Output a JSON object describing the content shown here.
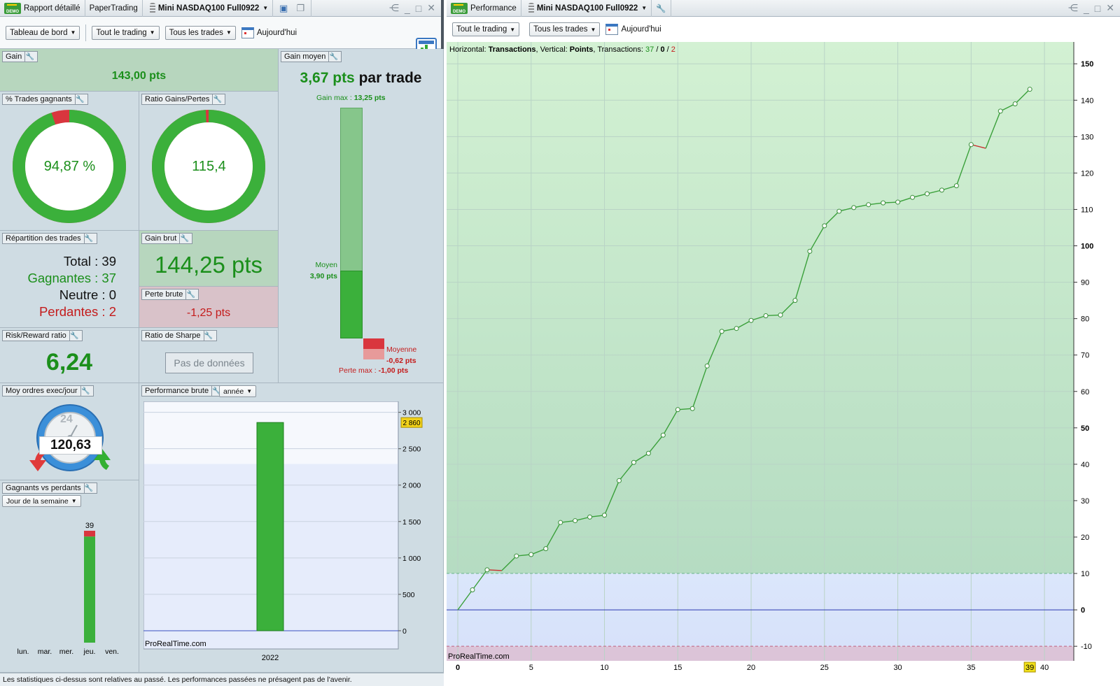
{
  "left_window": {
    "titlebar": {
      "demo_badge": "DEMO",
      "report_tab": "Rapport détaillé",
      "account": "PaperTrading",
      "instrument": "Mini NASDAQ100 Full0922"
    },
    "toolbar": {
      "dashboard": "Tableau de bord",
      "trading_filter": "Tout le trading",
      "trades_filter": "Tous les trades",
      "date_label": "Aujourd'hui"
    },
    "panels": {
      "gain": {
        "title": "Gain",
        "value": "143,00 pts"
      },
      "gain_moyen": {
        "title": "Gain moyen",
        "value": "3,67 pts",
        "suffix": " par trade",
        "gain_max_label": "Gain max : ",
        "gain_max_value": "13,25 pts",
        "moyen_label": "Moyen",
        "moyen_value": "3,90 pts",
        "moyenne_label": "Moyenne",
        "moyenne_value": "-0,62 pts",
        "perte_max_label": "Perte max : ",
        "perte_max_value": "-1,00 pts",
        "bar_max_pts": 13.25,
        "bar_avg_gain_pts": 3.9,
        "bar_avg_loss_pts": -0.62,
        "bar_max_loss_pts": -1.0
      },
      "pct_winning": {
        "title": "% Trades gagnants",
        "value": "94,87 %",
        "fraction": 0.9487
      },
      "ratio_gains_pertes": {
        "title": "Ratio Gains/Pertes",
        "value": "115,4",
        "fraction": 0.9914
      },
      "repartition": {
        "title": "Répartition des trades",
        "total": "Total : 39",
        "gagnantes": "Gagnantes : 37",
        "neutre": "Neutre : 0",
        "perdantes": "Perdantes : 2"
      },
      "gain_brut": {
        "title": "Gain brut",
        "value": "144,25 pts"
      },
      "perte_brute": {
        "title": "Perte brute",
        "value": "-1,25 pts"
      },
      "risk_reward": {
        "title": "Risk/Reward ratio",
        "value": "6,24"
      },
      "sharpe": {
        "title": "Ratio de Sharpe",
        "value": "Pas de données"
      },
      "moy_ordres": {
        "title": "Moy ordres exec/jour",
        "gauge_label": "24",
        "value": "120,63"
      },
      "perf_brute": {
        "title": "Performance brute",
        "period": "année",
        "watermark": "ProRealTime.com",
        "marker": "2 860"
      },
      "gagnants_vs_perdants": {
        "title": "Gagnants vs perdants",
        "mode": "Jour de la semaine",
        "top_count": "39"
      }
    },
    "status": "Les statistiques ci-dessus sont relatives au passé. Les performances passées ne présagent pas de l'avenir."
  },
  "right_window": {
    "titlebar": {
      "demo_badge": "DEMO",
      "tab": "Performance",
      "instrument": "Mini NASDAQ100 Full0922"
    },
    "toolbar": {
      "trading_filter": "Tout le trading",
      "trades_filter": "Tous les trades",
      "date_label": "Aujourd'hui"
    },
    "chart_header": {
      "h_label": "Horizontal: ",
      "h_value": "Transactions",
      "v_label": ", Vertical: ",
      "v_value": "Points",
      "t_label": ", Transactions: ",
      "t_win": "37",
      "t_sep1": " / ",
      "t_neutral": "0",
      "t_sep2": " / ",
      "t_loss": "2"
    },
    "watermark": "ProRealTime.com",
    "x_highlight": "39"
  },
  "chart_data": [
    {
      "type": "line",
      "title": "",
      "xlabel": "Transactions",
      "ylabel": "Points",
      "xlim": [
        0,
        42
      ],
      "ylim": [
        -14,
        156
      ],
      "x_ticks": [
        0,
        5,
        10,
        15,
        20,
        25,
        30,
        35,
        40
      ],
      "y_ticks": [
        -10,
        0,
        10,
        20,
        30,
        40,
        50,
        60,
        70,
        80,
        90,
        100,
        110,
        120,
        130,
        140,
        150
      ],
      "grid": true,
      "series": [
        {
          "x": [
            0,
            1,
            2,
            3,
            4,
            5,
            6,
            7,
            8,
            9,
            10,
            11,
            12,
            13,
            14,
            15,
            16,
            17,
            18,
            19,
            20,
            21,
            22,
            23,
            24,
            25,
            26,
            27,
            28,
            29,
            30,
            31,
            32,
            33,
            34,
            35,
            36,
            37,
            38,
            39
          ],
          "values": [
            0,
            5.5,
            11,
            10.8,
            14.8,
            15.2,
            16.8,
            24,
            24.5,
            25.5,
            26,
            35.5,
            40.5,
            43,
            48,
            55,
            55.3,
            67,
            76.5,
            77.3,
            79.5,
            80.8,
            81,
            85,
            98.5,
            105.5,
            109.5,
            110.5,
            111.3,
            111.8,
            112,
            113.3,
            114.3,
            115.3,
            116.5,
            127.8,
            126.8,
            137,
            139,
            143
          ]
        }
      ],
      "losing_trades": [
        3,
        36
      ],
      "zones": {
        "green_above": 10,
        "red_below": -10
      },
      "colors": {
        "line": "#3aa03a",
        "loss_segment": "#c83030",
        "zero_line": "#2a38b0"
      }
    },
    {
      "type": "bar",
      "title": "Performance brute",
      "categories": [
        "2022"
      ],
      "values": [
        2860
      ],
      "ylim": [
        -250,
        3150
      ],
      "y_ticks": [
        0,
        500,
        1000,
        1500,
        2000,
        2500,
        3000
      ],
      "y_tick_labels": [
        "0",
        "500",
        "1 000",
        "1 500",
        "2 000",
        "2 500",
        "3 000"
      ],
      "grid": true
    },
    {
      "type": "bar",
      "title": "Gagnants vs perdants",
      "categories": [
        "lun.",
        "mar.",
        "mer.",
        "jeu.",
        "ven."
      ],
      "series": [
        {
          "name": "Gagnants",
          "values": [
            0,
            0,
            0,
            37,
            0
          ]
        },
        {
          "name": "Perdants",
          "values": [
            0,
            0,
            0,
            2,
            0
          ]
        }
      ]
    }
  ]
}
